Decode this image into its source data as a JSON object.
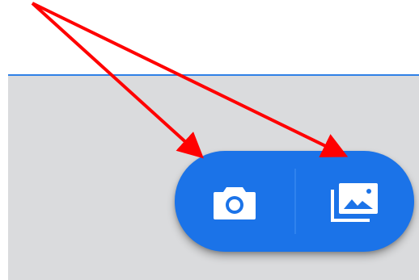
{
  "screen": {
    "accent_color": "#1b73e8",
    "panel_color": "#dadbdd",
    "rule_color": "#2f80e6"
  },
  "fab": {
    "camera_icon": "camera-icon",
    "gallery_icon": "gallery-icon"
  },
  "annotations": {
    "arrow_color": "#ff0000",
    "arrows": [
      "camera-arrow",
      "gallery-arrow"
    ]
  }
}
